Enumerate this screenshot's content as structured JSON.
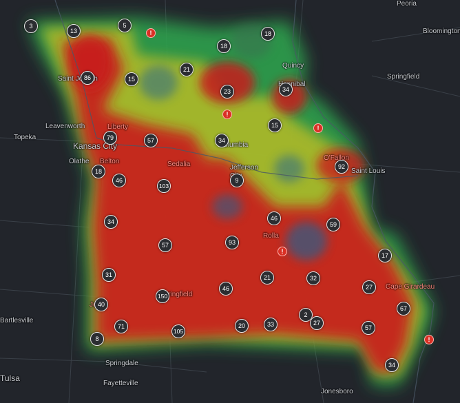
{
  "map": {
    "cities": [
      {
        "name": "Peoria",
        "cls": "city"
      },
      {
        "name": "Bloomington",
        "cls": "city"
      },
      {
        "name": "Quincy",
        "cls": "city"
      },
      {
        "name": "Hannibal",
        "cls": "city"
      },
      {
        "name": "Springfield",
        "cls": "city"
      },
      {
        "name": "Saint Joseph",
        "cls": "city"
      },
      {
        "name": "Topeka",
        "cls": "city"
      },
      {
        "name": "Leavenworth",
        "cls": "city"
      },
      {
        "name": "Liberty",
        "cls": "city red"
      },
      {
        "name": "Kansas City",
        "cls": "city large"
      },
      {
        "name": "Olathe",
        "cls": "city"
      },
      {
        "name": "Belton",
        "cls": "city red"
      },
      {
        "name": "Sedalia",
        "cls": "city red"
      },
      {
        "name": "Columbia",
        "cls": "city"
      },
      {
        "name": "Jefferson City",
        "cls": "city"
      },
      {
        "name": "O'Fallon",
        "cls": "city red"
      },
      {
        "name": "Saint Louis",
        "cls": "city"
      },
      {
        "name": "Rolla",
        "cls": "city red"
      },
      {
        "name": "Springfield",
        "cls": "city red"
      },
      {
        "name": "Joplin",
        "cls": "city red"
      },
      {
        "name": "Cape Girardeau",
        "cls": "city red"
      },
      {
        "name": "Bartlesville",
        "cls": "city"
      },
      {
        "name": "Springdale",
        "cls": "city"
      },
      {
        "name": "Fayetteville",
        "cls": "city"
      },
      {
        "name": "Tulsa",
        "cls": "city large"
      },
      {
        "name": "Jonesboro",
        "cls": "city"
      }
    ],
    "clusters": [
      "3",
      "13",
      "5",
      "18",
      "18",
      "21",
      "15",
      "86",
      "23",
      "34",
      "15",
      "79",
      "57",
      "34",
      "18",
      "46",
      "103",
      "9",
      "92",
      "34",
      "46",
      "59",
      "57",
      "93",
      "31",
      "21",
      "32",
      "17",
      "40",
      "150",
      "46",
      "27",
      "67",
      "2",
      "27",
      "71",
      "105",
      "20",
      "33",
      "57",
      "8",
      "34"
    ],
    "alerts": [
      "!",
      "!",
      "!",
      "!",
      "!"
    ]
  }
}
